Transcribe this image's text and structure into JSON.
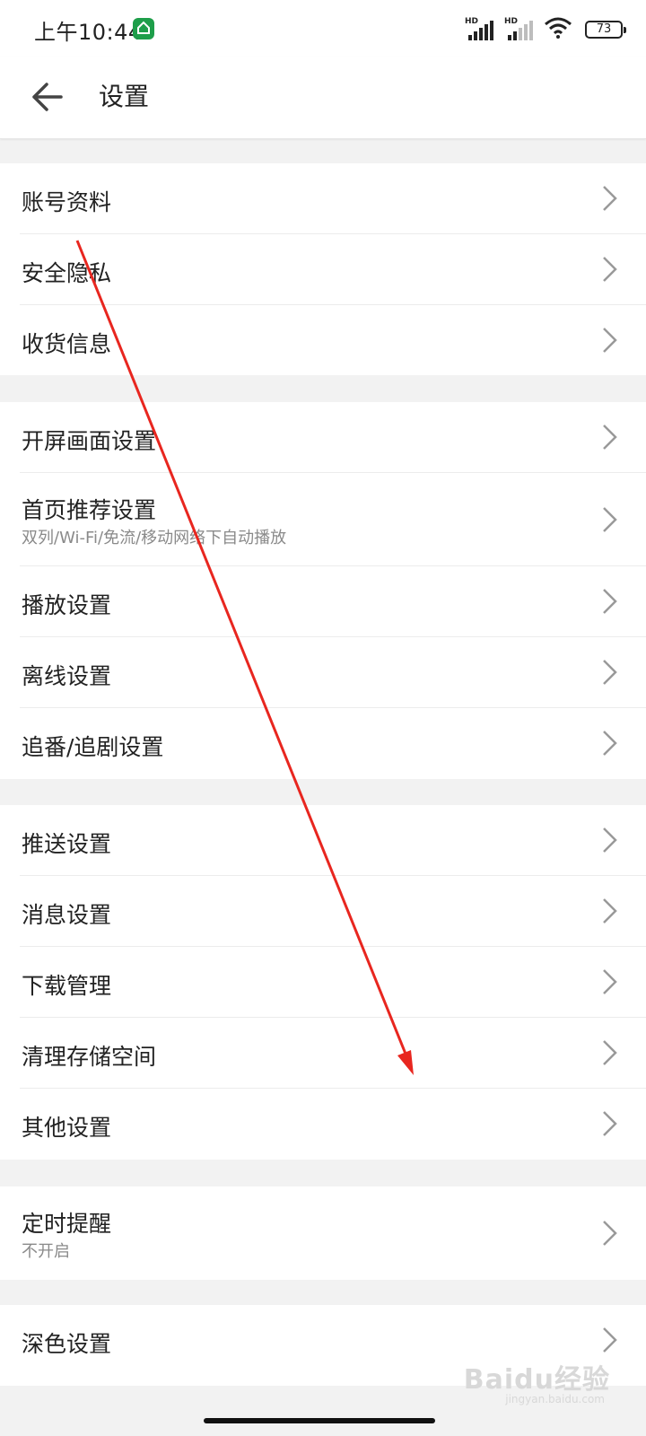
{
  "status_bar": {
    "time": "上午10:44",
    "hd1": "HD",
    "hd2": "HD",
    "battery": "73"
  },
  "header": {
    "title": "设置",
    "back_icon": "arrow-left-icon"
  },
  "groups": [
    {
      "items": [
        {
          "label": "账号资料"
        },
        {
          "label": "安全隐私"
        },
        {
          "label": "收货信息"
        }
      ]
    },
    {
      "items": [
        {
          "label": "开屏画面设置"
        },
        {
          "label": "首页推荐设置",
          "sub": "双列/Wi-Fi/免流/移动网络下自动播放"
        },
        {
          "label": "播放设置"
        },
        {
          "label": "离线设置"
        },
        {
          "label": "追番/追剧设置"
        }
      ]
    },
    {
      "items": [
        {
          "label": "推送设置"
        },
        {
          "label": "消息设置"
        },
        {
          "label": "下载管理"
        },
        {
          "label": "清理存储空间"
        },
        {
          "label": "其他设置"
        }
      ]
    },
    {
      "items": [
        {
          "label": "定时提醒",
          "sub": "不开启"
        }
      ]
    },
    {
      "items": [
        {
          "label": "深色设置"
        }
      ]
    }
  ],
  "watermark": {
    "text": "Baidu经验",
    "sub": "jingyan.baidu.com"
  },
  "colors": {
    "annotation": "#e8261f",
    "badge": "#1e9e4a"
  }
}
